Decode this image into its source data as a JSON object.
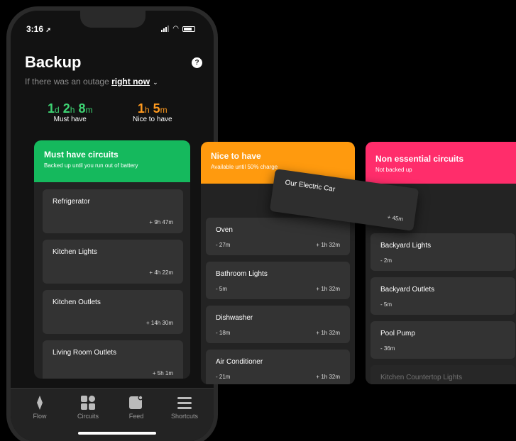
{
  "status": {
    "time": "3:16"
  },
  "header": {
    "title": "Backup",
    "help": "?",
    "subtitle_prefix": "If there was an outage",
    "subtitle_link": "right now",
    "subtitle_chevron": "⌄"
  },
  "stats": [
    {
      "d": "1",
      "du": "d",
      "h": "2",
      "hu": "h",
      "m": "8",
      "mu": "m",
      "label": "Must have",
      "color": "#3ed373"
    },
    {
      "h": "1",
      "hu": "h",
      "m": "5",
      "mu": "m",
      "label": "Nice to have",
      "color": "#ff9a1f"
    }
  ],
  "panels": {
    "must": {
      "title": "Must have circuits",
      "subtitle": "Backed up until you run out of battery",
      "color": "#15b95d",
      "items": [
        {
          "name": "Refrigerator",
          "right": "+ 9h 47m"
        },
        {
          "name": "Kitchen Lights",
          "right": "+ 4h 22m"
        },
        {
          "name": "Kitchen Outlets",
          "right": "+ 14h 30m"
        },
        {
          "name": "Living Room Outlets",
          "right": "+ 5h 1m"
        }
      ]
    },
    "nice": {
      "title": "Nice to have",
      "subtitle": "Available until 50% charge",
      "color": "#ff9a0e",
      "items": [
        {
          "name": "Oven",
          "left": "- 27m",
          "right": "+ 1h 32m"
        },
        {
          "name": "Bathroom Lights",
          "left": "- 5m",
          "right": "+ 1h 32m"
        },
        {
          "name": "Dishwasher",
          "left": "- 18m",
          "right": "+ 1h 32m"
        },
        {
          "name": "Air Conditioner",
          "left": "- 21m",
          "right": "+ 1h 32m"
        }
      ]
    },
    "nonessential": {
      "title": "Non essential circuits",
      "subtitle": "Not backed up",
      "color": "#ff2d6b",
      "items": [
        {
          "name": "Backyard Lights",
          "left": "- 2m"
        },
        {
          "name": "Backyard Outlets",
          "left": "- 5m"
        },
        {
          "name": "Pool Pump",
          "left": "- 36m"
        },
        {
          "name": "Kitchen Countertop Lights"
        }
      ]
    }
  },
  "drag_card": {
    "name": "Our Electric Car",
    "right": "+ 45m"
  },
  "tabs": [
    {
      "label": "Flow",
      "icon": "flow-icon"
    },
    {
      "label": "Circuits",
      "icon": "circuits-icon"
    },
    {
      "label": "Feed",
      "icon": "feed-icon"
    },
    {
      "label": "Shortcuts",
      "icon": "shortcuts-icon"
    }
  ]
}
